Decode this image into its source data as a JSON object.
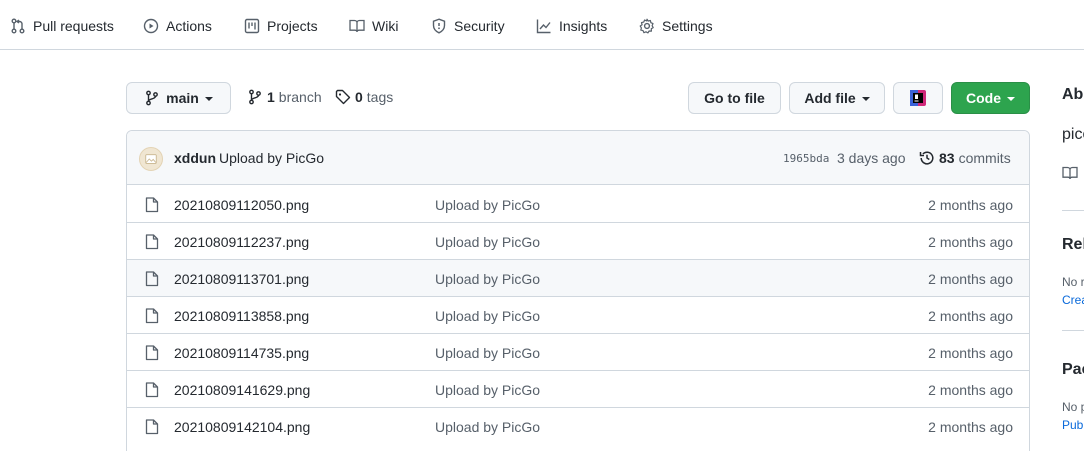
{
  "nav": {
    "items": [
      {
        "label": "Pull requests",
        "icon": "pull-request-icon"
      },
      {
        "label": "Actions",
        "icon": "play-icon"
      },
      {
        "label": "Projects",
        "icon": "project-icon"
      },
      {
        "label": "Wiki",
        "icon": "book-icon"
      },
      {
        "label": "Security",
        "icon": "shield-icon"
      },
      {
        "label": "Insights",
        "icon": "graph-icon"
      },
      {
        "label": "Settings",
        "icon": "gear-icon"
      }
    ]
  },
  "toolbar": {
    "branch_label": "main",
    "branch_count": "1",
    "branch_word": "branch",
    "tag_count": "0",
    "tag_word": "tags",
    "go_to_file": "Go to file",
    "add_file": "Add file",
    "code": "Code"
  },
  "commit": {
    "author": "xddun",
    "message": "Upload by PicGo",
    "sha": "1965bda",
    "age": "3 days ago",
    "count": "83",
    "count_word": "commits"
  },
  "files": [
    {
      "name": "20210809112050.png",
      "message": "Upload by PicGo",
      "age": "2 months ago"
    },
    {
      "name": "20210809112237.png",
      "message": "Upload by PicGo",
      "age": "2 months ago"
    },
    {
      "name": "20210809113701.png",
      "message": "Upload by PicGo",
      "age": "2 months ago"
    },
    {
      "name": "20210809113858.png",
      "message": "Upload by PicGo",
      "age": "2 months ago"
    },
    {
      "name": "20210809114735.png",
      "message": "Upload by PicGo",
      "age": "2 months ago"
    },
    {
      "name": "20210809141629.png",
      "message": "Upload by PicGo",
      "age": "2 months ago"
    },
    {
      "name": "20210809142104.png",
      "message": "Upload by PicGo",
      "age": "2 months ago"
    }
  ],
  "sidebar": {
    "about_heading": "Abo",
    "about_text": "pico",
    "releases_heading": "Rel",
    "releases_text": "No r",
    "releases_link": "Crea",
    "packages_heading": "Pac",
    "packages_text": "No p",
    "packages_link": "Publ"
  },
  "colors": {
    "accent_green": "#2da44e",
    "link_blue": "#0969da",
    "border": "#d0d7de"
  }
}
